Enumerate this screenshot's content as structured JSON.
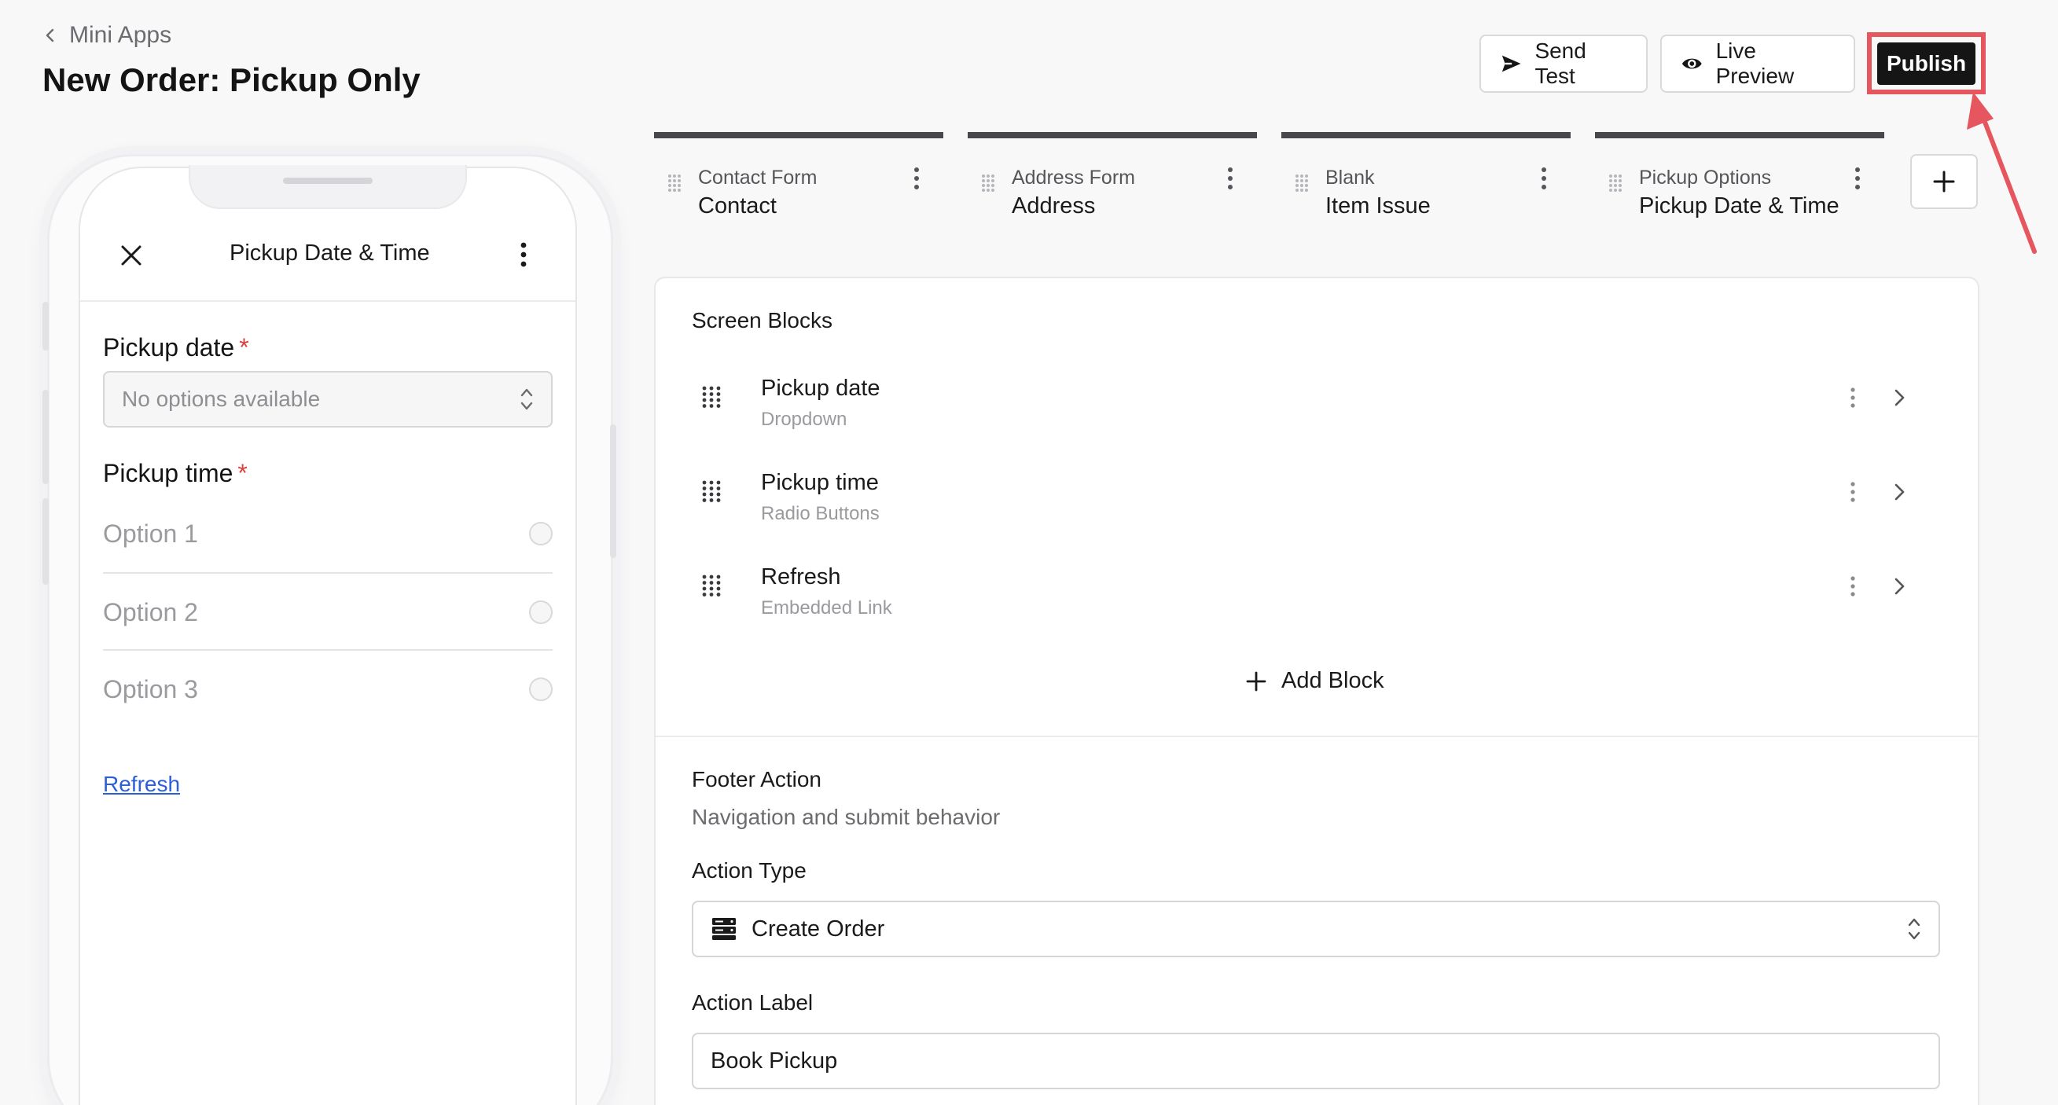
{
  "header": {
    "breadcrumb": "Mini Apps",
    "title": "New Order: Pickup Only",
    "send_test": "Send Test",
    "live_preview": "Live Preview",
    "publish": "Publish"
  },
  "phone": {
    "screen_title": "Pickup Date & Time",
    "pickup_date_label": "Pickup date",
    "required_mark": "*",
    "pickup_date_placeholder": "No options available",
    "pickup_time_label": "Pickup time",
    "options": [
      "Option 1",
      "Option 2",
      "Option 3"
    ],
    "link": "Refresh"
  },
  "tabs": [
    {
      "type": "Contact Form",
      "name": "Contact"
    },
    {
      "type": "Address Form",
      "name": "Address"
    },
    {
      "type": "Blank",
      "name": "Item Issue"
    },
    {
      "type": "Pickup Options",
      "name": "Pickup Date & Time"
    }
  ],
  "panel": {
    "screen_blocks_title": "Screen Blocks",
    "blocks": [
      {
        "name": "Pickup date",
        "type": "Dropdown"
      },
      {
        "name": "Pickup time",
        "type": "Radio Buttons"
      },
      {
        "name": "Refresh",
        "type": "Embedded Link"
      }
    ],
    "add_block": "Add Block",
    "footer_title": "Footer Action",
    "footer_subtitle": "Navigation and submit behavior",
    "action_type_label": "Action Type",
    "action_type_value": "Create Order",
    "action_label_label": "Action Label",
    "action_label_value": "Book Pickup"
  },
  "icons": {
    "back": "chevron-left-icon",
    "send": "send-icon",
    "eye": "eye-icon",
    "close": "close-icon",
    "more": "kebab-icon",
    "grip": "drag-handle-icon",
    "add": "plus-icon",
    "chevron": "chevron-right-icon",
    "server": "server-icon",
    "select": "chevron-up-down-icon"
  },
  "colors": {
    "publish_bg": "#151515",
    "highlight": "#e5565f",
    "link": "#2b5fd9",
    "required": "#d9413c"
  }
}
